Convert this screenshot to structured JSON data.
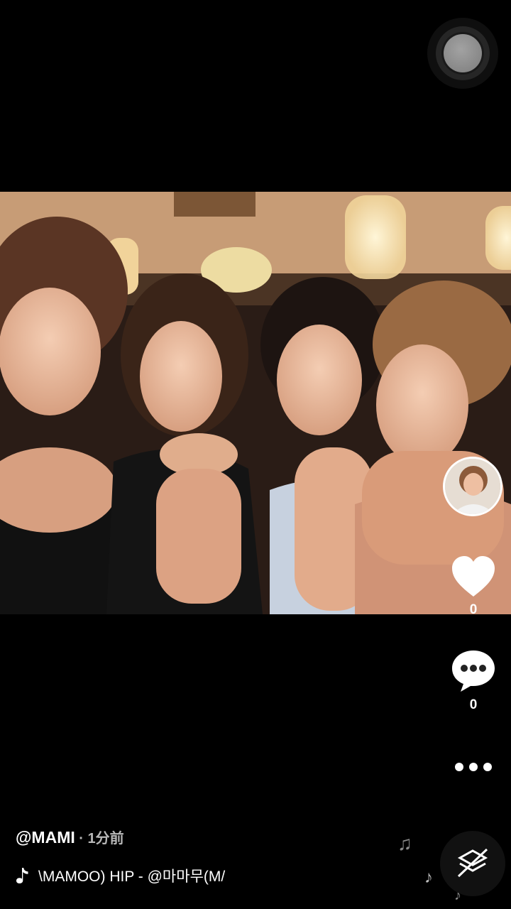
{
  "floating_button": {
    "icon": "assistive-touch-icon"
  },
  "video": {
    "description_icon": "photo-frame"
  },
  "sidebar": {
    "like": {
      "icon": "heart-icon",
      "count": "0"
    },
    "comment": {
      "icon": "comment-icon",
      "count": "0"
    },
    "more": {
      "icon": "more-dots-icon"
    }
  },
  "caption": {
    "username": "@MAMI",
    "time": " · 1分前"
  },
  "music": {
    "icon": "music-note-icon",
    "text": "\\MAMOO)    HIP - @마마무(M/"
  },
  "colors": {
    "background": "#000000",
    "text": "#ffffff",
    "muted": "#b8b8b8"
  }
}
